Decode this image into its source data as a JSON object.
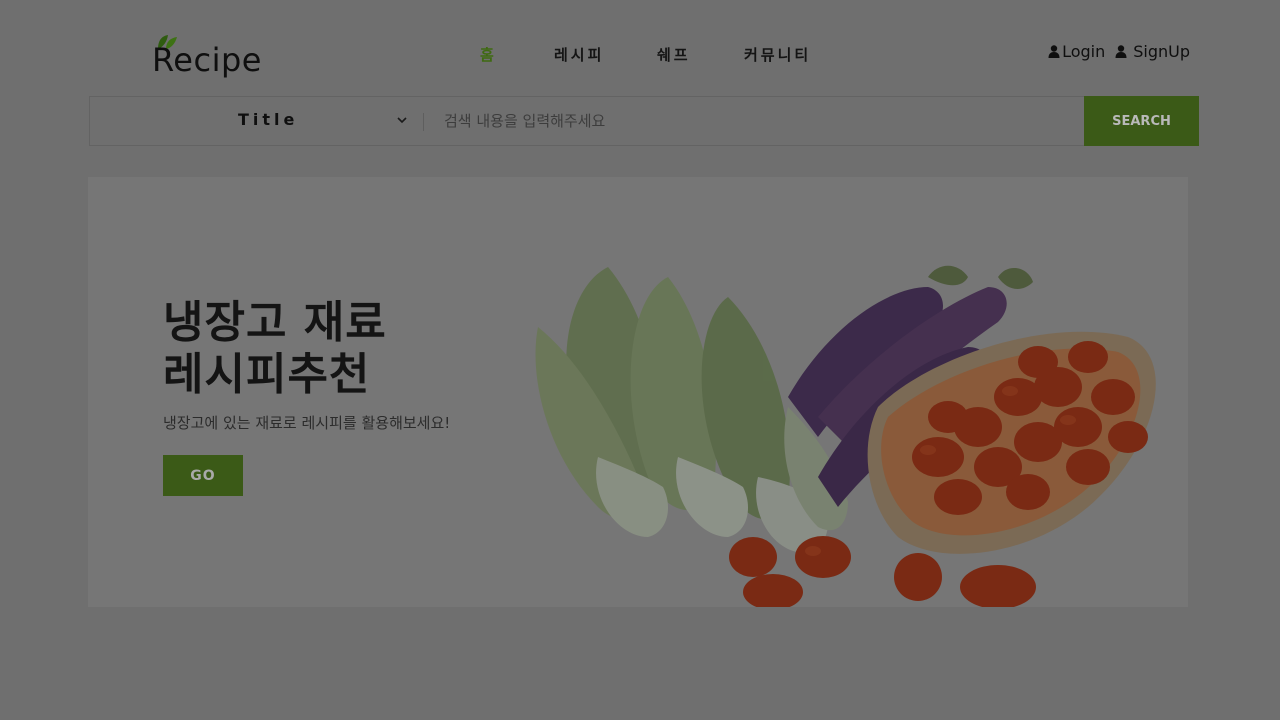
{
  "header": {
    "logo_text": "Recipe",
    "nav": [
      {
        "label": "홈",
        "active": true
      },
      {
        "label": "레시피",
        "active": false
      },
      {
        "label": "쉐프",
        "active": false
      },
      {
        "label": "커뮤니티",
        "active": false
      }
    ],
    "login_label": "Login",
    "signup_label": "SignUp"
  },
  "search": {
    "selected_option": "Title",
    "placeholder": "검색 내용을 입력해주세요",
    "button_label": "SEARCH"
  },
  "hero": {
    "title_line1": "냉장고 재료",
    "title_line2": "레시피추천",
    "subtitle": "냉장고에 있는 재료로 레시피를 활용해보세요!",
    "button_label": "GO"
  },
  "colors": {
    "accent": "#3b5a17",
    "active_nav": "#3f6a12",
    "overlay_bg": "#6f6f6f"
  },
  "icons": {
    "logo_leaf": "leaf-icon",
    "user": "user-icon",
    "dropdown": "chevron-down-icon"
  }
}
